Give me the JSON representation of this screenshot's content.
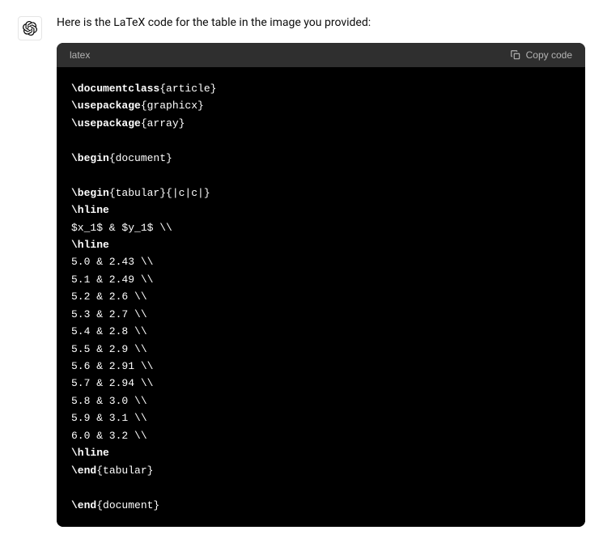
{
  "intro": "Here is the LaTeX code for the table in the image you provided:",
  "code": {
    "lang": "latex",
    "copy_label": "Copy code",
    "lines": [
      "\\documentclass{article}",
      "\\usepackage{graphicx}",
      "\\usepackage{array}",
      "",
      "\\begin{document}",
      "",
      "\\begin{tabular}{|c|c|}",
      "\\hline",
      "$x_1$ & $y_1$ \\\\",
      "\\hline",
      "5.0 & 2.43 \\\\",
      "5.1 & 2.49 \\\\",
      "5.2 & 2.6 \\\\",
      "5.3 & 2.7 \\\\",
      "5.4 & 2.8 \\\\",
      "5.5 & 2.9 \\\\",
      "5.6 & 2.91 \\\\",
      "5.7 & 2.94 \\\\",
      "5.8 & 3.0 \\\\",
      "5.9 & 3.1 \\\\",
      "6.0 & 3.2 \\\\",
      "\\hline",
      "\\end{tabular}",
      "",
      "\\end{document}"
    ]
  }
}
